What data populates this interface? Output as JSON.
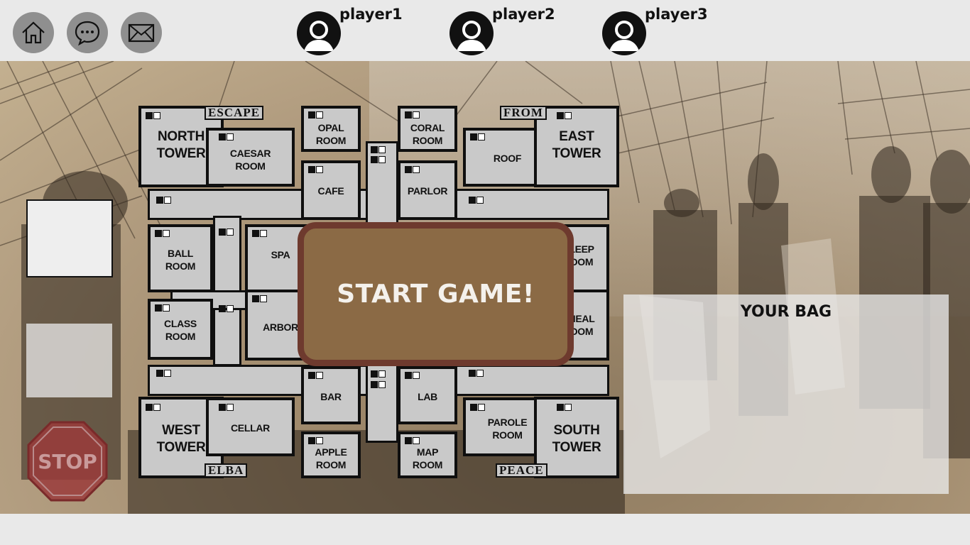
{
  "topbar": {
    "nav": [
      {
        "icon": "home-icon"
      },
      {
        "icon": "chat-icon"
      },
      {
        "icon": "mail-icon"
      }
    ],
    "players": [
      {
        "name": "player1",
        "icon": "user-icon"
      },
      {
        "name": "player2",
        "icon": "user-icon"
      },
      {
        "name": "player3",
        "icon": "user-icon"
      }
    ]
  },
  "board": {
    "corner_tags": {
      "top_left": "ESCAPE",
      "top_right": "FROM",
      "bottom_left": "ELBA",
      "bottom_right": "PEACE"
    },
    "rooms": {
      "north_tower": [
        "NORTH",
        "TOWER"
      ],
      "caesar_room": [
        "CAESAR",
        "ROOM"
      ],
      "opal_room": [
        "OPAL",
        "ROOM"
      ],
      "cafe": [
        "CAFE"
      ],
      "coral_room": [
        "CORAL",
        "ROOM"
      ],
      "roof": [
        "ROOF"
      ],
      "parlor": [
        "PARLOR"
      ],
      "east_tower": [
        "EAST",
        "TOWER"
      ],
      "ball_room": [
        "BALL",
        "ROOM"
      ],
      "spa": [
        "SPA"
      ],
      "class_room": [
        "CLASS",
        "ROOM"
      ],
      "arbor": [
        "ARBOR"
      ],
      "sleep_room": [
        "LEEP",
        "OOM"
      ],
      "heal_room": [
        "HEAL",
        "OOM"
      ],
      "west_tower": [
        "WEST",
        "TOWER"
      ],
      "cellar": [
        "CELLAR"
      ],
      "bar": [
        "BAR"
      ],
      "apple_room": [
        "APPLE",
        "ROOM"
      ],
      "lab": [
        "LAB"
      ],
      "map_room": [
        "MAP",
        "ROOM"
      ],
      "parole_room": [
        "PAROLE",
        "ROOM"
      ],
      "south_tower": [
        "SOUTH",
        "TOWER"
      ]
    }
  },
  "start_button": {
    "label": "START GAME!"
  },
  "bag": {
    "title": "YOUR BAG"
  },
  "stop_button": {
    "label": "STOP",
    "icon": "stop-sign-icon"
  },
  "colors": {
    "start_fill": "#8b6a45",
    "start_border": "#6e3a2e",
    "stop_red": "#9a3b3b",
    "room_fill": "#c9c9c9"
  }
}
